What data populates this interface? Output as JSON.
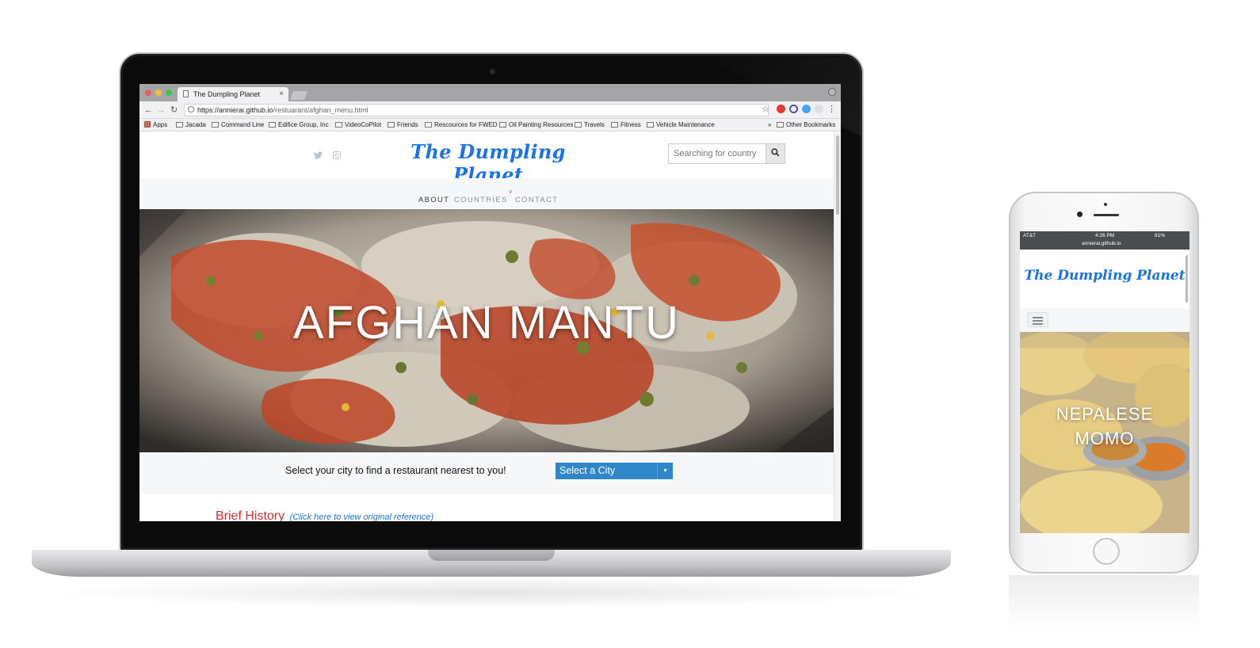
{
  "laptop": {
    "browser": {
      "tab_title": "The Dumpling Planet",
      "tab_close": "×",
      "url_host": "https://annierai.github.io",
      "url_path": "/restuarant/afghan_menu.html",
      "bookmarks": [
        "Apps",
        "Jacada",
        "Command Line",
        "Edifice Group, Inc",
        "VideoCoPilot",
        "Friends",
        "Rescources for FWED",
        "Oil Painting Resources",
        "Travels",
        "Fitness",
        "Vehicle Maintenance"
      ],
      "overflow": "»",
      "other_bookmarks": "Other Bookmarks",
      "back": "←",
      "forward": "→",
      "reload": "↻",
      "star": "☆",
      "menu": "⋮"
    },
    "site": {
      "brand": "The Dumpling Planet",
      "search_placeholder": "Searching for country",
      "search_icon": "⌕",
      "nav": [
        "ABOUT",
        "COUNTRIES",
        "CONTACT"
      ],
      "hero_title": "AFGHAN MANTU",
      "city_prompt": "Select your city to find a restaurant nearest to you!",
      "city_select": "Select a City",
      "city_caret": "▼",
      "history_title": "Brief History",
      "history_link": "(Click here to view original reference)"
    }
  },
  "phone": {
    "status": {
      "carrier": "AT&T",
      "time": "4:26 PM",
      "battery": "81%",
      "url": "annierai.github.io"
    },
    "site": {
      "brand": "The Dumpling Planet",
      "hero_title_line1": "NEPALESE",
      "hero_title_line2": "MOMO"
    }
  },
  "colors": {
    "brand_blue": "#1a73e8",
    "select_blue": "#2f87c9",
    "history_red": "#d32f2f",
    "nav_bg": "#f6f7f9"
  }
}
